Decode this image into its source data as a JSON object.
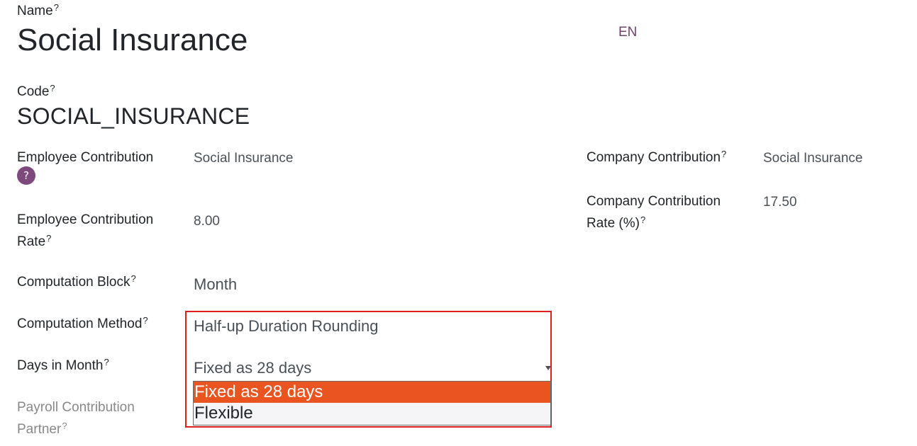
{
  "name_field": {
    "label": "Name",
    "help": "?",
    "value": "Social Insurance",
    "lang": "EN"
  },
  "code_field": {
    "label": "Code",
    "help": "?",
    "value": "SOCIAL_INSURANCE"
  },
  "left_fields": {
    "employee_contribution": {
      "label": "Employee Contribution",
      "help": "?",
      "value": "Social Insurance"
    },
    "employee_contribution_rate": {
      "label_line1": "Employee Contribution",
      "label_line2": "Rate",
      "help": "?",
      "value": "8.00"
    },
    "computation_block": {
      "label": "Computation Block",
      "help": "?",
      "value": "Month"
    },
    "computation_method": {
      "label": "Computation Method",
      "help": "?",
      "value": "Half-up Duration Rounding"
    },
    "days_in_month": {
      "label": "Days in Month",
      "help": "?",
      "value": "Fixed as 28 days",
      "options": [
        "Fixed as 28 days",
        "Flexible"
      ],
      "selected_index": 0
    },
    "payroll_contribution_partner": {
      "label_line1": "Payroll Contribution",
      "label_line2": "Partner",
      "help": "?"
    }
  },
  "right_fields": {
    "company_contribution": {
      "label": "Company Contribution",
      "help": "?",
      "value": "Social Insurance"
    },
    "company_contribution_rate": {
      "label_line1": "Company Contribution",
      "label_line2": "Rate (%)",
      "help": "?",
      "value": "17.50"
    }
  },
  "colors": {
    "accent": "#71416d",
    "help_badge": "#7e4a7e",
    "highlight_border": "#e01e1e",
    "option_selected_bg": "#e95420"
  }
}
